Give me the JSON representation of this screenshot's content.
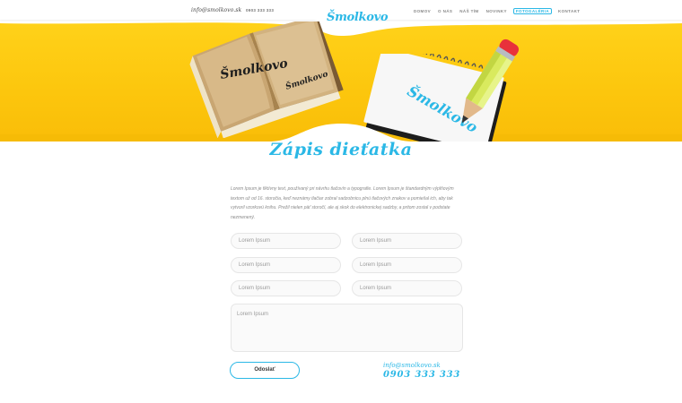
{
  "header": {
    "email": "info@smolkovo.sk",
    "phone": "0903 333 333",
    "logo": "Šmolkovo",
    "nav": [
      {
        "label": "Domov",
        "active": false
      },
      {
        "label": "O nás",
        "active": false
      },
      {
        "label": "Náš tím",
        "active": false
      },
      {
        "label": "Novinky",
        "active": false
      },
      {
        "label": "Fotogaléria",
        "active": true
      },
      {
        "label": "Kontakt",
        "active": false
      }
    ]
  },
  "hero": {
    "book_logo": "Šmolkovo",
    "notebook_logo": "Šmolkovo"
  },
  "page": {
    "title": "Zápis dieťatka",
    "intro": "Lorem Ipsum je fiktívny text, používaný pri návrhu tlačovín a typografie. Lorem Ipsum je štandardným výplňovým textom už od 16. storočia, keď neznámy tlačiar zobral sadzobnicu plnú tlačových znakov a pomiešal ich, aby tak vytvoril vzorkovú knihu. Prežil nielen päť storočí, ale aj skok do elektronickej sadzby, a pritom zostal v podstate nezmenený."
  },
  "form": {
    "fields": [
      {
        "placeholder": "Lorem Ipsum"
      },
      {
        "placeholder": "Lorem Ipsum"
      },
      {
        "placeholder": "Lorem Ipsum"
      },
      {
        "placeholder": "Lorem Ipsum"
      },
      {
        "placeholder": "Lorem Ipsum"
      },
      {
        "placeholder": "Lorem Ipsum"
      }
    ],
    "message_placeholder": "Lorem Ipsum",
    "submit_label": "Odoslať"
  },
  "contact": {
    "email": "info@smolkovo.sk",
    "phone": "0903 333 333"
  },
  "colors": {
    "accent": "#2bb8e6",
    "hero_yellow": "#fcc60d"
  }
}
